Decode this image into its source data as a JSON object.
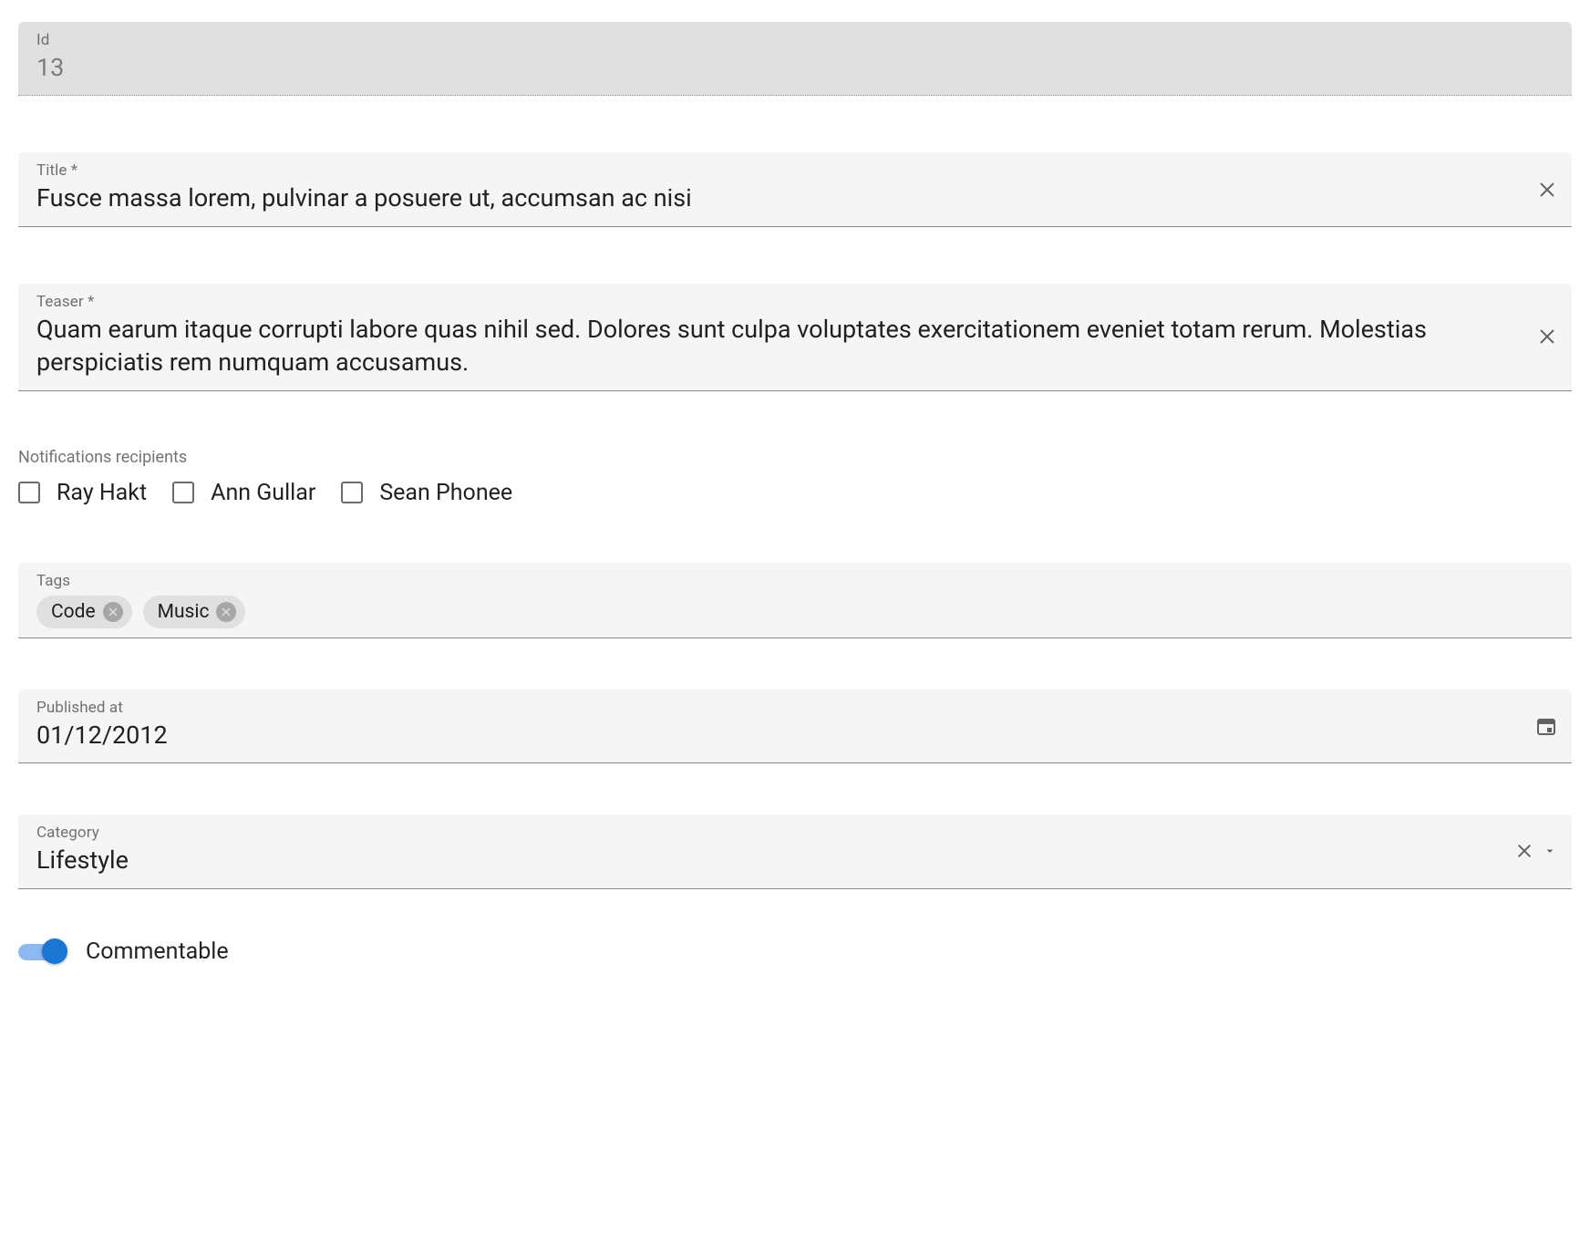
{
  "id_field": {
    "label": "Id",
    "value": "13"
  },
  "title_field": {
    "label": "Title *",
    "value": "Fusce massa lorem, pulvinar a posuere ut, accumsan ac nisi"
  },
  "teaser_field": {
    "label": "Teaser *",
    "value": "Quam earum itaque corrupti labore quas nihil sed. Dolores sunt culpa voluptates exercitationem eveniet totam rerum. Molestias perspiciatis rem numquam accusamus."
  },
  "recipients": {
    "label": "Notifications recipients",
    "options": [
      "Ray Hakt",
      "Ann Gullar",
      "Sean Phonee"
    ]
  },
  "tags_field": {
    "label": "Tags",
    "chips": [
      "Code",
      "Music"
    ]
  },
  "published_field": {
    "label": "Published at",
    "value": "01/12/2012"
  },
  "category_field": {
    "label": "Category",
    "value": "Lifestyle"
  },
  "commentable": {
    "label": "Commentable",
    "value": true
  }
}
